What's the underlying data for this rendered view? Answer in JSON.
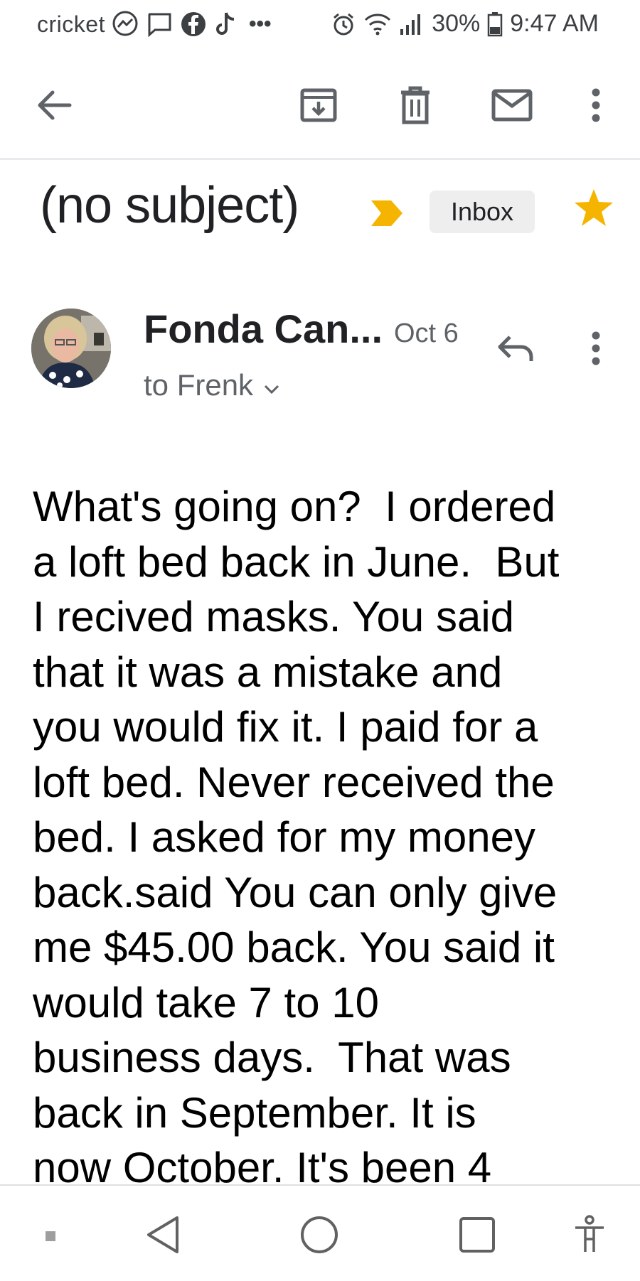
{
  "status_bar": {
    "carrier": "cricket",
    "battery": "30%",
    "time": "9:47 AM",
    "more": "•••"
  },
  "toolbar": {
    "back_icon": "arrow-left-icon",
    "archive_icon": "archive-icon",
    "delete_icon": "trash-icon",
    "mark_unread_icon": "mail-icon",
    "more_icon": "more-vertical-icon"
  },
  "email": {
    "subject": "(no subject)",
    "label": "Inbox",
    "starred": true,
    "sender": "Fonda Can...",
    "date": "Oct 6",
    "recipient": "to Frenk",
    "body_lines": [
      "What's going on?  I ordered",
      "a loft bed back in June.  But",
      "I recived masks. You said",
      "that it was a mistake and",
      "you would fix it. I paid for a",
      "loft bed. Never received the",
      "bed. I asked for my money",
      "back.said You can only give",
      "me $45.00 back. You said it",
      "would take 7 to 10",
      "business days.  That was",
      "back in September. It is",
      "now October. It's been 4"
    ]
  },
  "colors": {
    "star": "#f4b400",
    "importance": "#f4b400",
    "badge_bg": "#eeeeee",
    "icon_gray": "#5f6368"
  },
  "nav_bar": {
    "back_icon": "triangle-back-icon",
    "home_icon": "circle-home-icon",
    "recents_icon": "square-recents-icon",
    "accessibility_icon": "accessibility-icon"
  }
}
